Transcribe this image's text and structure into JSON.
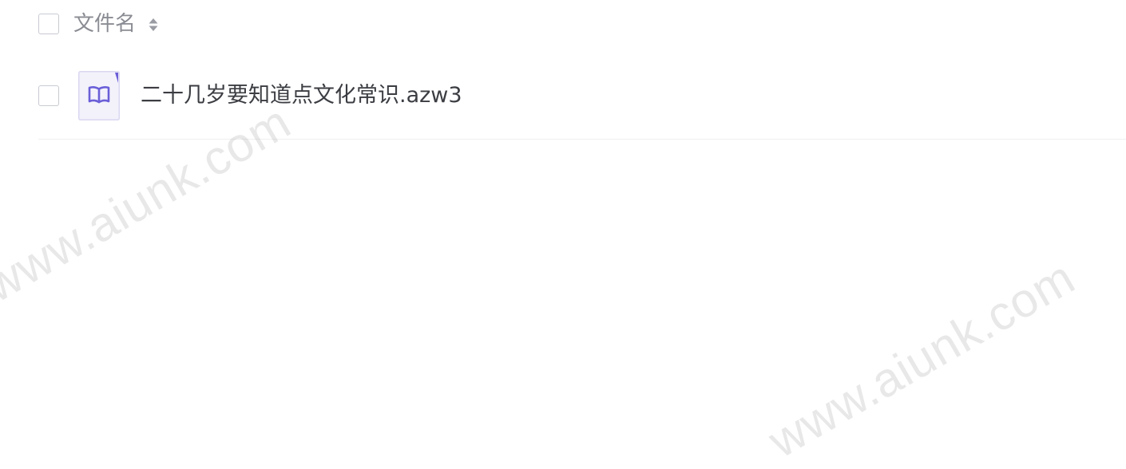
{
  "file_list": {
    "header": {
      "column_label": "文件名",
      "sort_icon": "sort-both-icon"
    },
    "files": [
      {
        "name": "二十几岁要知道点文化常识.azw3",
        "icon": "ebook-icon",
        "icon_color": "#6a5fd8"
      }
    ]
  },
  "watermark": {
    "text": "www.aiunk.com"
  },
  "colors": {
    "header_text": "#8a8c93",
    "file_text": "#3b3d42",
    "checkbox_border": "#c9cbd1",
    "row_divider": "#eeeff2",
    "file_icon_bg": "#f3f2fb",
    "file_icon_accent": "#6a5fd8"
  }
}
